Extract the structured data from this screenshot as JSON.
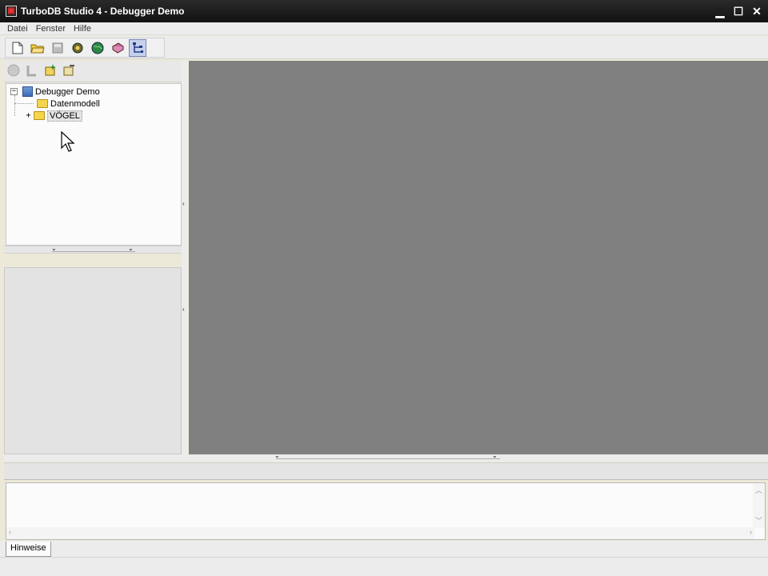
{
  "window": {
    "title": "TurboDB Studio 4 - Debugger Demo",
    "icon": "turbodb-app-icon"
  },
  "menu": {
    "items": [
      {
        "label": "Datei"
      },
      {
        "label": "Fenster"
      },
      {
        "label": "Hilfe"
      }
    ]
  },
  "toolbar": {
    "buttons": [
      {
        "icon": "new-document-icon"
      },
      {
        "icon": "open-folder-icon"
      },
      {
        "icon": "save-disk-icon"
      },
      {
        "icon": "gear-tool-icon"
      },
      {
        "icon": "globe-icon"
      },
      {
        "icon": "book-icon"
      },
      {
        "icon": "tree-structure-icon",
        "active": true
      }
    ]
  },
  "left_panel": {
    "tree": {
      "root": {
        "label": "Debugger Demo",
        "expanded": true
      },
      "children": [
        {
          "label": "Datenmodell",
          "expandable": false
        },
        {
          "label": "VÖGEL",
          "expandable": true,
          "selected": true
        }
      ]
    }
  },
  "output": {
    "tabs": [
      {
        "label": "Hinweise",
        "active": true
      }
    ]
  },
  "colors": {
    "workspace": "#808080",
    "titlebar": "#1a1a1a",
    "chrome": "#ececec"
  }
}
